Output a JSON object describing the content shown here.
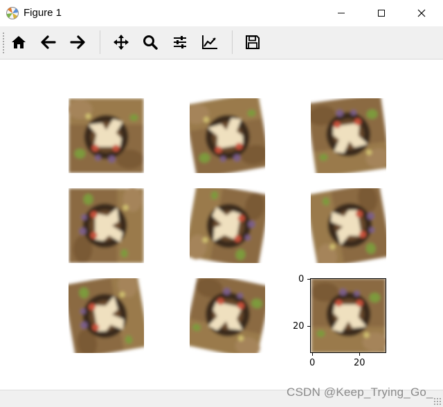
{
  "window": {
    "title": "Figure 1",
    "app_icon": "matplotlib-icon",
    "controls": [
      "minimize-icon",
      "maximize-icon",
      "close-icon"
    ]
  },
  "toolbar": {
    "buttons": [
      {
        "name": "home",
        "icon": "home-icon"
      },
      {
        "name": "back",
        "icon": "arrow-left-icon"
      },
      {
        "name": "forward",
        "icon": "arrow-right-icon"
      },
      {
        "name": "pan",
        "icon": "move-icon"
      },
      {
        "name": "zoom",
        "icon": "magnifier-icon"
      },
      {
        "name": "subplots",
        "icon": "sliders-icon"
      },
      {
        "name": "customize",
        "icon": "chart-line-icon"
      },
      {
        "name": "save",
        "icon": "floppy-disk-icon"
      }
    ]
  },
  "figure": {
    "subplots": 9,
    "grid": "3x3",
    "content": "augmented images of a frog (32x32 pixels)",
    "last_axes": {
      "yticks": [
        "0",
        "20"
      ],
      "xticks": [
        "0",
        "20"
      ]
    }
  },
  "watermark": "CSDN @Keep_Trying_Go_",
  "colors": {
    "toolbar_bg": "#f0f0f0",
    "image_brown": "#8b6a43",
    "frog_light": "#efe0bf",
    "frog_dark": "#3b2a1a",
    "accent_red": "#c8513a",
    "leaf_green": "#7d9a3c"
  }
}
